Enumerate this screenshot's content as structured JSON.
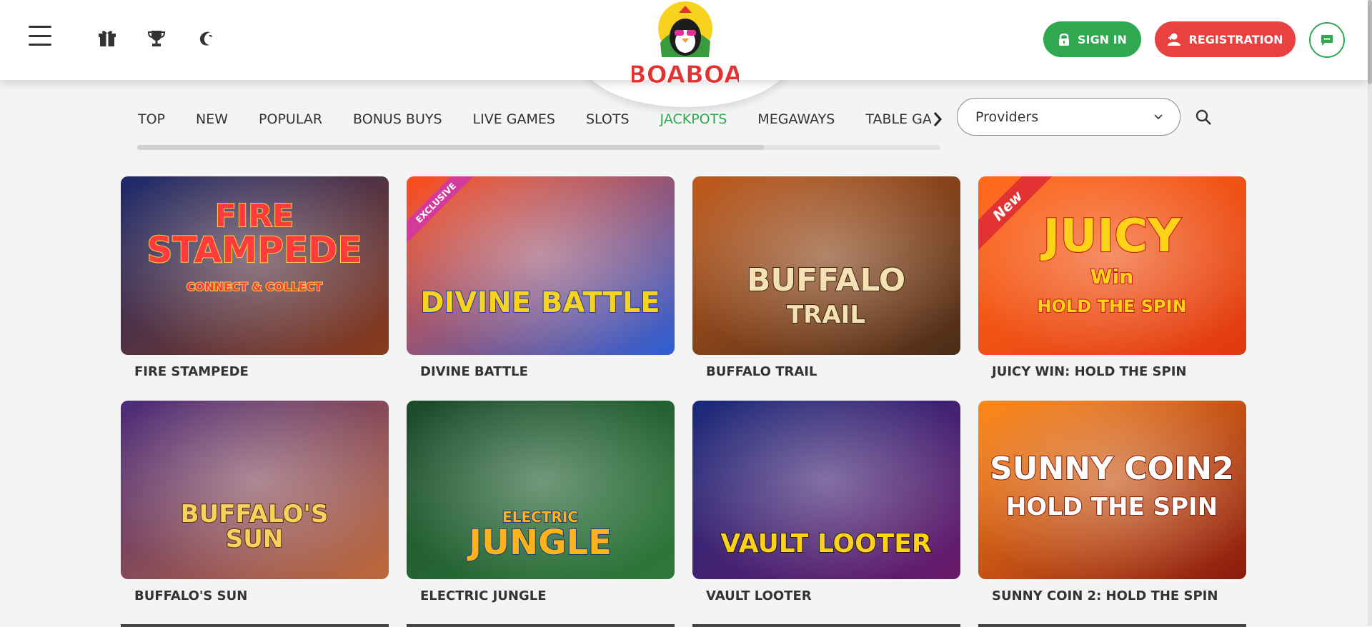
{
  "header": {
    "sign_in": "SIGN IN",
    "registration": "REGISTRATION",
    "logo_text": "BOABOA",
    "icons": [
      "menu-icon",
      "gift-icon",
      "trophy-icon",
      "moon-icon",
      "lock-icon",
      "user-plus-icon",
      "chat-icon"
    ]
  },
  "nav": {
    "tabs": [
      "TOP",
      "NEW",
      "POPULAR",
      "BONUS BUYS",
      "LIVE GAMES",
      "SLOTS",
      "JACKPOTS",
      "MEGAWAYS",
      "TABLE GAMES"
    ],
    "active": "JACKPOTS",
    "scroll_progress": 0.78
  },
  "providers": {
    "label": "Providers"
  },
  "games": [
    {
      "name": "FIRE STAMPEDE",
      "art": [
        "FIRE",
        "STAMPEDE",
        "CONNECT & COLLECT"
      ],
      "tag": ""
    },
    {
      "name": "DIVINE BATTLE",
      "art": [
        "DIVINE BATTLE"
      ],
      "tag": "EXCLUSIVE"
    },
    {
      "name": "BUFFALO TRAIL",
      "art": [
        "BUFFALO",
        "TRAIL"
      ],
      "tag": ""
    },
    {
      "name": "JUICY WIN: HOLD THE SPIN",
      "art": [
        "JUICY",
        "Win",
        "HOLD THE SPIN"
      ],
      "tag": "New"
    },
    {
      "name": "BUFFALO'S SUN",
      "art": [
        "BUFFALO'S",
        "SUN"
      ],
      "tag": ""
    },
    {
      "name": "ELECTRIC JUNGLE",
      "art": [
        "ELECTRIC",
        "JUNGLE"
      ],
      "tag": ""
    },
    {
      "name": "VAULT LOOTER",
      "art": [
        "VAULT LOOTER"
      ],
      "tag": ""
    },
    {
      "name": "SUNNY COIN 2: HOLD THE SPIN",
      "art": [
        "SUNNY COIN2",
        "HOLD THE SPIN"
      ],
      "tag": ""
    }
  ],
  "colors": {
    "green": "#2fa84f",
    "red": "#e94040",
    "text": "#333333"
  }
}
